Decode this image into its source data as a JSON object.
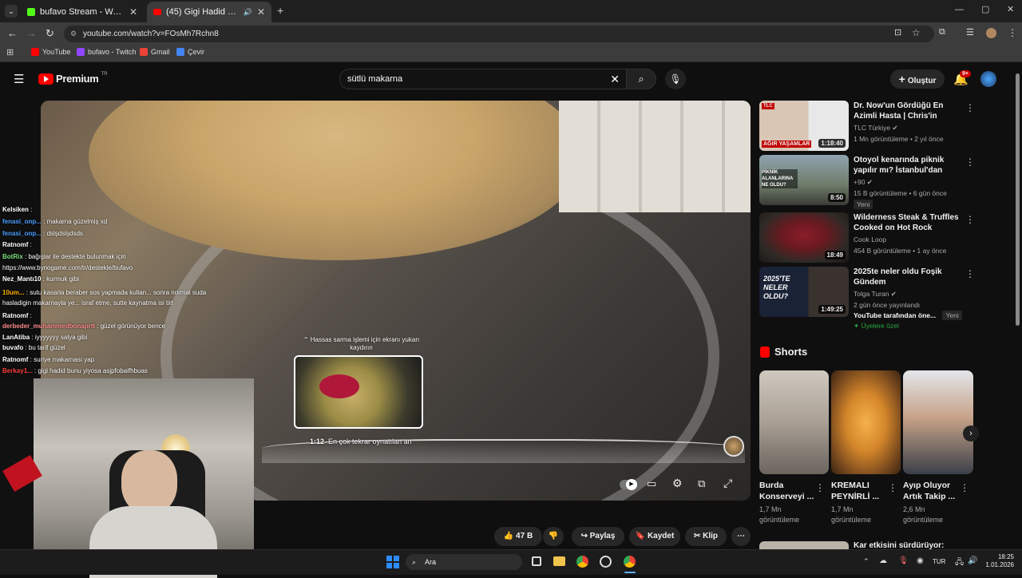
{
  "browser": {
    "tabs": [
      {
        "label": "bufavo Stream - Watch Live on",
        "icon": "kick-icon"
      },
      {
        "label": "(45) Gigi Hadid Makarna Ta",
        "icon": "youtube-icon"
      }
    ],
    "url": "youtube.com/watch?v=FOsMh7Rchn8",
    "bookmarks": [
      {
        "label": "YouTube",
        "color": "#ff0000"
      },
      {
        "label": "bufavo - Twitch",
        "color": "#9146ff"
      },
      {
        "label": "Gmail",
        "color": "#ea4335"
      },
      {
        "label": "Çevir",
        "color": "#4285f4"
      }
    ]
  },
  "youtube": {
    "logo": "Premium",
    "logo_suffix": "TR",
    "search_value": "sütlü makarna",
    "create_label": "Oluştur",
    "notif_badge": "9+"
  },
  "player": {
    "preview_hint": "Hassas sarma işlemi için ekranı yukarı kaydırın",
    "preview_time": "1:12",
    "preview_label": "En çok tekrar oynatılan an"
  },
  "chat": [
    {
      "user": "Kelsiken",
      "text": "",
      "color": "#ffffff"
    },
    {
      "user": "fenasi_onp...",
      "text": "makarna güzelmiş xd",
      "color": "#4a9eff"
    },
    {
      "user": "fenasi_onp...",
      "text": "dslşdslşdsds",
      "color": "#4a9eff"
    },
    {
      "user": "Ratnomf",
      "text": "",
      "color": "#ffffff"
    },
    {
      "user": "BotRix",
      "text": "bağışlar ile destekte bulunmak için",
      "color": "#7ee07e"
    },
    {
      "user": "",
      "text": "https://www.bynogame.com/tr/destekle/bufavo",
      "color": "#ffffff"
    },
    {
      "user": "Nez_Mantı10",
      "text": "kurmuk gibi",
      "color": "#ffffff"
    },
    {
      "user": "10um...",
      "text": "sutu kasarla beraber sos yapmada kullan... sonra normal suda",
      "color": "#ffb000"
    },
    {
      "user": "",
      "text": "hasladigin makarnayla ye... israf etme, sutte kaynatma isi tirt",
      "color": "#ffffff"
    },
    {
      "user": "Ratnomf",
      "text": "",
      "color": "#ffffff"
    },
    {
      "user": "derbeder_muhammedbonaprtt",
      "text": "güzel görünüyor bence",
      "color": "#ff8c8c"
    },
    {
      "user": "LanAtiba",
      "text": "iyyyyyyy salya gibi",
      "color": "#ffffff"
    },
    {
      "user": "buvafo",
      "text": "bu tarif güzel",
      "color": "#ffffff"
    },
    {
      "user": "Ratnomf",
      "text": "suriye makarnası yap",
      "color": "#ffffff"
    },
    {
      "user": "Berkay1...",
      "text": "gigi hadid bunu yiyosa asjpfobaifhbuas",
      "color": "#ff4040"
    }
  ],
  "actions": {
    "like_count": "47 B",
    "share_label": "Paylaş",
    "save_label": "Kaydet",
    "clip_label": "Klip"
  },
  "recommendations": [
    {
      "title": "Dr. Now'un Gördüğü En Azimli Hasta | Chris'in Hikayesi | Ağır ...",
      "channel": "TLC Türkiye",
      "meta": "1 Mn görüntüleme • 2 yıl önce",
      "duration": "1:18:40",
      "badge": "",
      "thumb_label": "AĞIR YAŞAMLAR"
    },
    {
      "title": "Otoyol kenarında piknik yapılır mı? İstanbul'dan manzaralar",
      "channel": "+90",
      "meta": "15 B görüntüleme • 6 gün önce",
      "duration": "8:50",
      "badge": "Yeni",
      "thumb_label": "PİKNİK ALANLARINA NE OLDU?"
    },
    {
      "title": "Wilderness Steak & Truffles Cooked on Hot Rock",
      "channel": "Cook Loop",
      "meta": "454 B görüntüleme • 1 ay önce",
      "duration": "18:49",
      "badge": "",
      "thumb_label": ""
    },
    {
      "title": "2025te neler oldu Foşik Gündem",
      "channel": "Tolga Turan",
      "meta": "2 gün önce yayınlandı",
      "duration": "1:49:25",
      "badge": "Yeni",
      "extra": "YouTube tarafından öne...",
      "members": "Üyelere özel",
      "thumb_label": "2025'TE NELER OLDU?"
    }
  ],
  "shorts": {
    "heading": "Shorts",
    "items": [
      {
        "title": "Burda Konserveyi ...",
        "views": "1,7 Mn",
        "views_label": "görüntüleme"
      },
      {
        "title": "KREMALI PEYNİRLİ ...",
        "views": "1,7 Mn",
        "views_label": "görüntüleme"
      },
      {
        "title": "Ayıp Oluyor Artık Takip ...",
        "views": "2,6 Mn",
        "views_label": "görüntüleme"
      }
    ]
  },
  "next_item": {
    "title": "Kar etkisini sürdürüyor:"
  },
  "taskbar": {
    "search_label": "Ara",
    "lang": "TUR",
    "time": "18:25",
    "date": "1.01.2026"
  }
}
